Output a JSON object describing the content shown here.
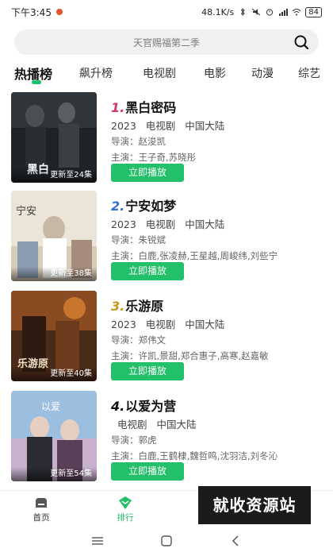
{
  "status_bar": {
    "time": "下午3:45",
    "network_speed": "48.1K/s",
    "battery": "84"
  },
  "search": {
    "placeholder": "天官赐福第二季"
  },
  "tabs": [
    {
      "label": "热播榜",
      "active": true
    },
    {
      "label": "飙升榜",
      "active": false
    },
    {
      "label": "电视剧",
      "active": false
    },
    {
      "label": "电影",
      "active": false
    },
    {
      "label": "动漫",
      "active": false
    },
    {
      "label": "综艺",
      "active": false
    }
  ],
  "items": [
    {
      "rank": "1.",
      "rank_color": "#d6336c",
      "title": "黑白密码",
      "year": "2023",
      "type": "电视剧",
      "region": "中国大陆",
      "director": "导演：赵浚凯",
      "cast": "主演：王子奇,苏晓彤",
      "episodes": "更新至24集",
      "play_label": "立即播放",
      "poster_colors": [
        "#1f2328",
        "#3b3f44",
        "#5a5f63"
      ]
    },
    {
      "rank": "2.",
      "rank_color": "#2f6fd6",
      "title": "宁安如梦",
      "year": "2023",
      "type": "电视剧",
      "region": "中国大陆",
      "director": "导演：朱锐斌",
      "cast": "主演：白鹿,张凌赫,王星越,周峻纬,刘些宁",
      "episodes": "更新至38集",
      "play_label": "立即播放",
      "poster_colors": [
        "#e9e3d6",
        "#cdbfae",
        "#8b9bb0"
      ]
    },
    {
      "rank": "3.",
      "rank_color": "#c9981d",
      "title": "乐游原",
      "year": "2023",
      "type": "电视剧",
      "region": "中国大陆",
      "director": "导演：郑伟文",
      "cast": "主演：许凯,景甜,郑合惠子,高寒,赵嘉敏",
      "episodes": "更新至40集",
      "play_label": "立即播放",
      "poster_colors": [
        "#3a2418",
        "#8a4a22",
        "#c9752e"
      ]
    },
    {
      "rank": "4.",
      "rank_color": "#111111",
      "title": "以爱为营",
      "year": "",
      "type": "电视剧",
      "region": "中国大陆",
      "director": "导演：郭虎",
      "cast": "主演：白鹿,王鹤棣,魏哲鸣,沈羽洁,刘冬沁",
      "episodes": "更新至54集",
      "play_label": "立即播放",
      "poster_colors": [
        "#8fb4d8",
        "#c7b1cc",
        "#5a3f58"
      ]
    }
  ],
  "bottom_nav": [
    {
      "label": "首页",
      "active": false,
      "icon": "home-icon"
    },
    {
      "label": "排行",
      "active": true,
      "icon": "ranking-icon"
    }
  ],
  "watermark": "就收资源站",
  "colors": {
    "accent": "#22c068"
  }
}
